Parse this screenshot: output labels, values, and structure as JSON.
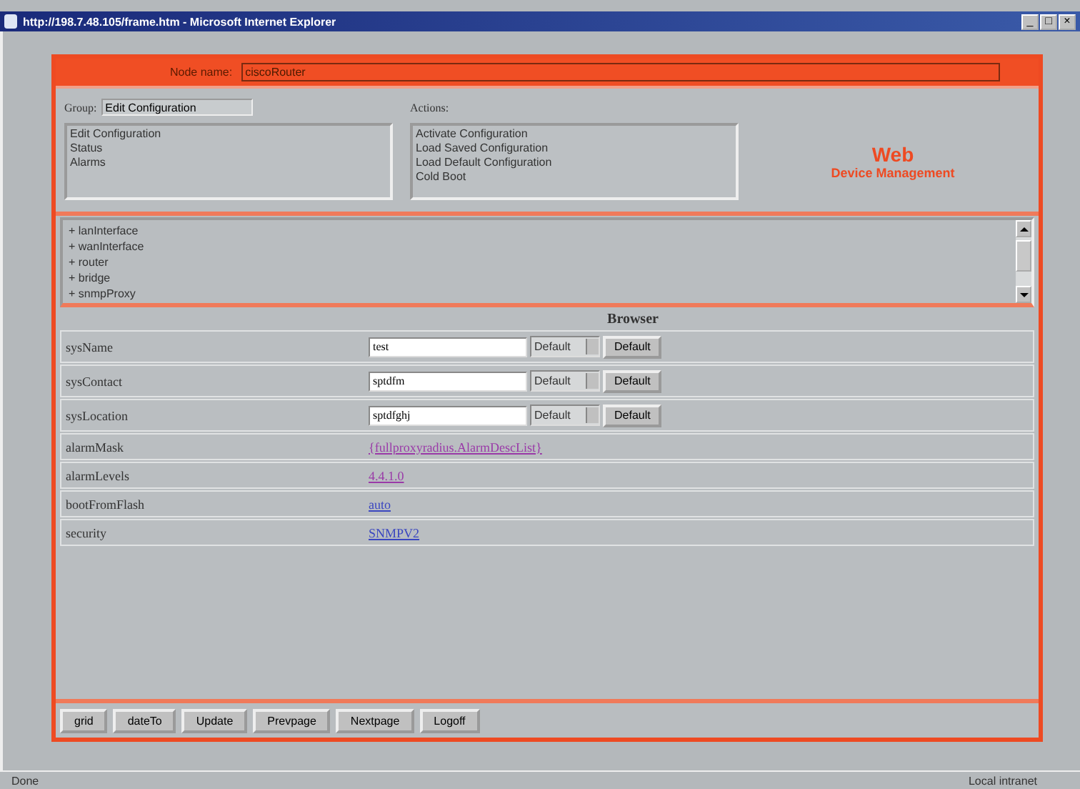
{
  "window": {
    "title": "http://198.7.48.105/frame.htm - Microsoft Internet Explorer",
    "controls": [
      "_",
      "□",
      "×"
    ]
  },
  "node_name": {
    "label": "Node name:",
    "value": "ciscoRouter"
  },
  "group": {
    "label": "Group:",
    "value": "Edit Configuration",
    "items": [
      "Edit Configuration",
      "Status",
      "Alarms"
    ]
  },
  "actions": {
    "label": "Actions:",
    "items": [
      "Activate Configuration",
      "Load Saved Configuration",
      "Load Default Configuration",
      "Cold Boot"
    ]
  },
  "brand": {
    "title": "Web",
    "subtitle": "Device Management"
  },
  "tree": [
    "+ lanInterface",
    "+ wanInterface",
    "+ router",
    "+ bridge",
    "+ snmpProxy"
  ],
  "browser": {
    "title": "Browser",
    "rows": [
      {
        "kind": "input",
        "name": "sysName",
        "value": "test",
        "select": "Default",
        "button": "Default"
      },
      {
        "kind": "input",
        "name": "sysContact",
        "value": "sptdfm",
        "select": "Default",
        "button": "Default"
      },
      {
        "kind": "input",
        "name": "sysLocation",
        "value": "sptdfghj",
        "select": "Default",
        "button": "Default"
      },
      {
        "kind": "link",
        "name": "alarmMask",
        "value": "{fullproxyradius.AlarmDescList}",
        "visited": true
      },
      {
        "kind": "link",
        "name": "alarmLevels",
        "value": "4.4.1.0",
        "visited": true
      },
      {
        "kind": "link",
        "name": "bootFromFlash",
        "value": "auto",
        "visited": false
      },
      {
        "kind": "link",
        "name": "security",
        "value": "SNMPV2",
        "visited": false
      }
    ]
  },
  "buttons": [
    "grid",
    "dateTo",
    "Update",
    "Prevpage",
    "Nextpage",
    "Logoff"
  ],
  "status_bar": {
    "left": "Done",
    "right": "Local intranet"
  }
}
